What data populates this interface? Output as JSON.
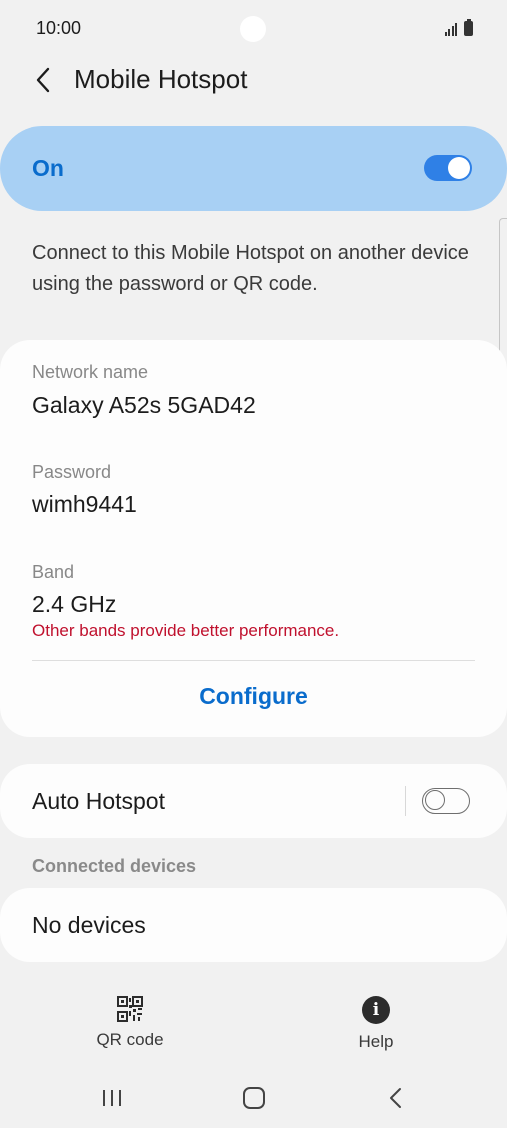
{
  "status_bar": {
    "time": "10:00",
    "signal_icon": "signal-bars-icon",
    "battery_icon": "battery-icon"
  },
  "header": {
    "back_icon": "chevron-left-icon",
    "title": "Mobile Hotspot"
  },
  "master_switch": {
    "label": "On",
    "enabled": true,
    "accent_color": "#2f80e6",
    "background_color": "#a8d0f4"
  },
  "description": "Connect to this Mobile Hotspot on another device using the password or QR code.",
  "network": {
    "name_label": "Network name",
    "name_value": "Galaxy A52s 5GAD42",
    "password_label": "Password",
    "password_value": "wimh9441",
    "band_label": "Band",
    "band_value": "2.4 GHz",
    "band_note": "Other bands provide better performance.",
    "band_note_color": "#c0112e",
    "configure_label": "Configure"
  },
  "auto_hotspot": {
    "label": "Auto Hotspot",
    "enabled": false
  },
  "connected_devices": {
    "header": "Connected devices",
    "empty_label": "No devices"
  },
  "bottom_actions": {
    "qr_label": "QR code",
    "qr_icon": "qr-code-icon",
    "help_label": "Help",
    "help_icon": "info-icon"
  },
  "nav_bar": {
    "recent_icon": "recent-apps-icon",
    "home_icon": "home-icon",
    "back_icon": "back-icon"
  }
}
